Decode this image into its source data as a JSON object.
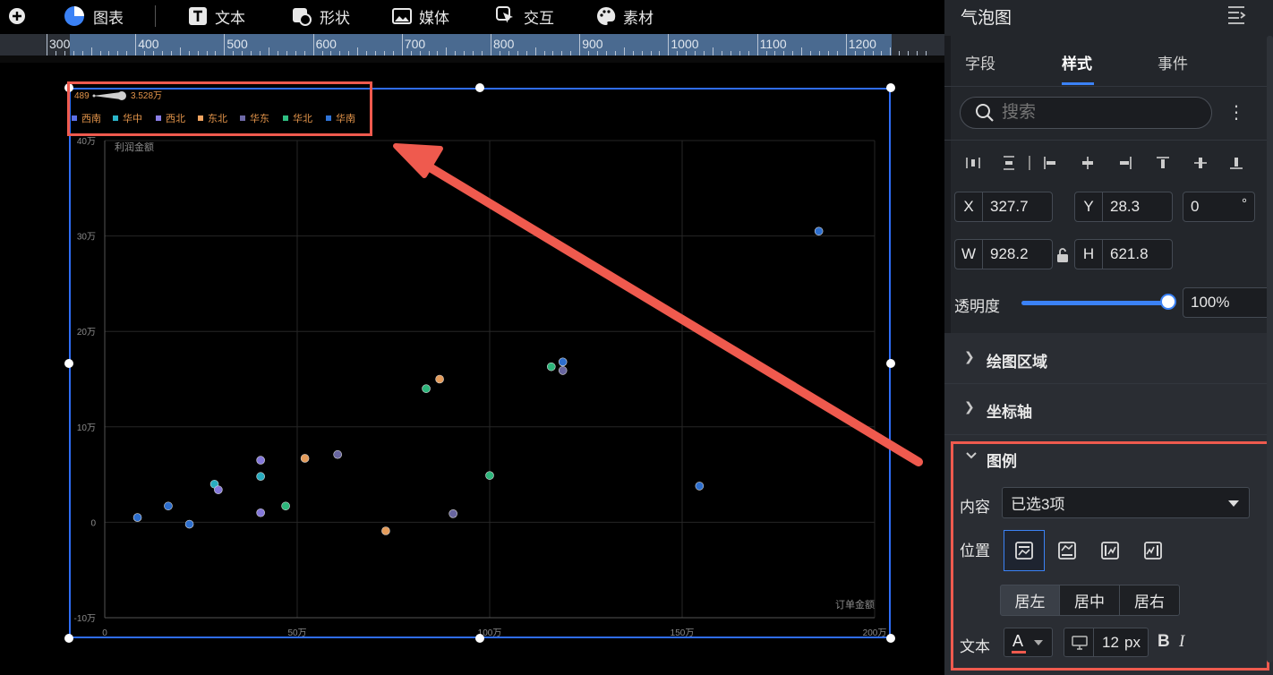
{
  "toolbar": {
    "items": [
      {
        "label": "图表",
        "icon": "pie-chart-icon"
      },
      {
        "label": "文本",
        "icon": "text-icon"
      },
      {
        "label": "形状",
        "icon": "shape-icon"
      },
      {
        "label": "媒体",
        "icon": "image-icon"
      },
      {
        "label": "交互",
        "icon": "interaction-icon"
      },
      {
        "label": "素材",
        "icon": "palette-icon"
      }
    ]
  },
  "ruler": {
    "labels": [
      "300",
      "400",
      "500",
      "600",
      "700",
      "800",
      "900",
      "1000",
      "1100",
      "1200"
    ]
  },
  "chart_data": {
    "type": "scatter",
    "size_legend": {
      "min_label": "489",
      "max_label": "3.528万"
    },
    "legend": [
      {
        "name": "西南",
        "color": "#5b6fe8"
      },
      {
        "name": "华中",
        "color": "#2bb5c9"
      },
      {
        "name": "西北",
        "color": "#8b7ee6"
      },
      {
        "name": "东北",
        "color": "#f0a460"
      },
      {
        "name": "华东",
        "color": "#6e6aa8"
      },
      {
        "name": "华北",
        "color": "#2fbf82"
      },
      {
        "name": "华南",
        "color": "#2f74d8"
      }
    ],
    "xlabel": "订单金额",
    "ylabel": "利润金额",
    "xlim": [
      0,
      200
    ],
    "ylim": [
      -10,
      40
    ],
    "x_ticks": [
      "0",
      "50万",
      "100万",
      "150万",
      "200万"
    ],
    "y_ticks": [
      "40万",
      "30万",
      "20万",
      "10万",
      "0",
      "-10万"
    ],
    "unit": "万",
    "points": [
      {
        "series": "华南",
        "x": 8.5,
        "y": 0.5
      },
      {
        "series": "华南",
        "x": 16.5,
        "y": 1.7
      },
      {
        "series": "华南",
        "x": 22.0,
        "y": -0.2
      },
      {
        "series": "华中",
        "x": 28.5,
        "y": 4.0
      },
      {
        "series": "西北",
        "x": 29.5,
        "y": 3.4
      },
      {
        "series": "西北",
        "x": 40.5,
        "y": 6.5
      },
      {
        "series": "华中",
        "x": 40.5,
        "y": 4.8
      },
      {
        "series": "西北",
        "x": 40.5,
        "y": 1.0
      },
      {
        "series": "华北",
        "x": 47.0,
        "y": 1.7
      },
      {
        "series": "东北",
        "x": 52.0,
        "y": 6.7
      },
      {
        "series": "华东",
        "x": 60.5,
        "y": 7.1
      },
      {
        "series": "东北",
        "x": 73.0,
        "y": -0.9
      },
      {
        "series": "华北",
        "x": 83.5,
        "y": 14.0
      },
      {
        "series": "东北",
        "x": 87.0,
        "y": 15.0
      },
      {
        "series": "华东",
        "x": 90.5,
        "y": 0.9
      },
      {
        "series": "华北",
        "x": 100.0,
        "y": 4.9
      },
      {
        "series": "华北",
        "x": 116.0,
        "y": 16.3
      },
      {
        "series": "华南",
        "x": 119.0,
        "y": 16.8
      },
      {
        "series": "华东",
        "x": 119.0,
        "y": 15.9
      },
      {
        "series": "华南",
        "x": 154.5,
        "y": 3.8
      },
      {
        "series": "华南",
        "x": 185.5,
        "y": 30.5
      }
    ]
  },
  "panel": {
    "title": "气泡图",
    "tabs": [
      "字段",
      "样式",
      "事件"
    ],
    "active_tab": "样式",
    "search_placeholder": "搜索",
    "x_label": "X",
    "x_value": "327.7",
    "y_label": "Y",
    "y_value": "28.3",
    "rotation_value": "0",
    "rotation_unit": "°",
    "w_label": "W",
    "w_value": "928.2",
    "h_label": "H",
    "h_value": "621.8",
    "opacity_label": "透明度",
    "opacity_value": "100%",
    "opacity_level": 1.0,
    "sections": {
      "plot_area": "绘图区域",
      "axis": "坐标轴",
      "legend": "图例"
    },
    "legend_section": {
      "content_label": "内容",
      "content_value": "已选3项",
      "position_label": "位置",
      "align_options": [
        "居左",
        "居中",
        "居右"
      ],
      "align_selected": "居左",
      "text_label": "文本",
      "font_color_glyph": "A",
      "font_size": "12",
      "font_size_unit": "px",
      "bold_glyph": "B",
      "italic_glyph": "I"
    },
    "accent": "#3b82f6",
    "highlight": "#ef5a4e"
  }
}
